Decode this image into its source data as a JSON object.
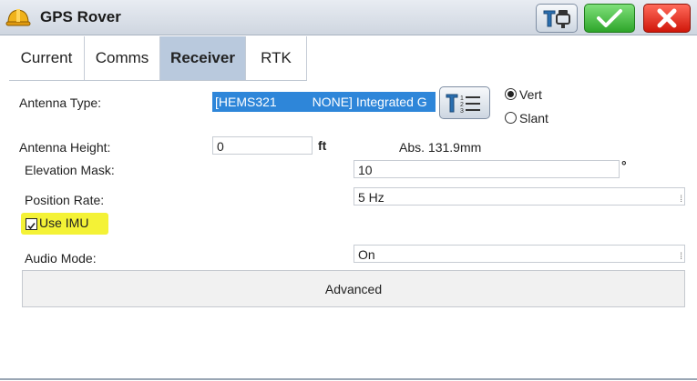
{
  "title": "GPS Rover",
  "icons": {
    "app": "hardhat-icon",
    "tools": "tools-icon",
    "ok": "checkmark-icon",
    "close": "close-icon",
    "list": "numbered-list-icon"
  },
  "tabs": [
    {
      "label": "Current",
      "active": false
    },
    {
      "label": "Comms",
      "active": false
    },
    {
      "label": "Receiver",
      "active": true
    },
    {
      "label": "RTK",
      "active": false
    }
  ],
  "antenna": {
    "label": "Antenna Type:",
    "value": "[HEMS321          NONE] Integrated G",
    "vert_label": "Vert",
    "slant_label": "Slant",
    "selected": "Vert"
  },
  "height": {
    "label": "Antenna Height:",
    "value": "0",
    "unit": "ft",
    "abs": "Abs. 131.9mm"
  },
  "elevation": {
    "label": "Elevation Mask:",
    "value": "10",
    "unit": "°"
  },
  "position_rate": {
    "label": "Position Rate:",
    "value": "5 Hz"
  },
  "imu": {
    "label": "Use IMU",
    "checked": true
  },
  "audio": {
    "label": "Audio Mode:",
    "value": "On"
  },
  "advanced_label": "Advanced",
  "colors": {
    "ok_green": "#2ea52a",
    "close_red": "#d0170a",
    "tab_active": "#b9c9dd",
    "select_blue": "#2e86d9",
    "highlight_yellow": "#f4f236"
  }
}
